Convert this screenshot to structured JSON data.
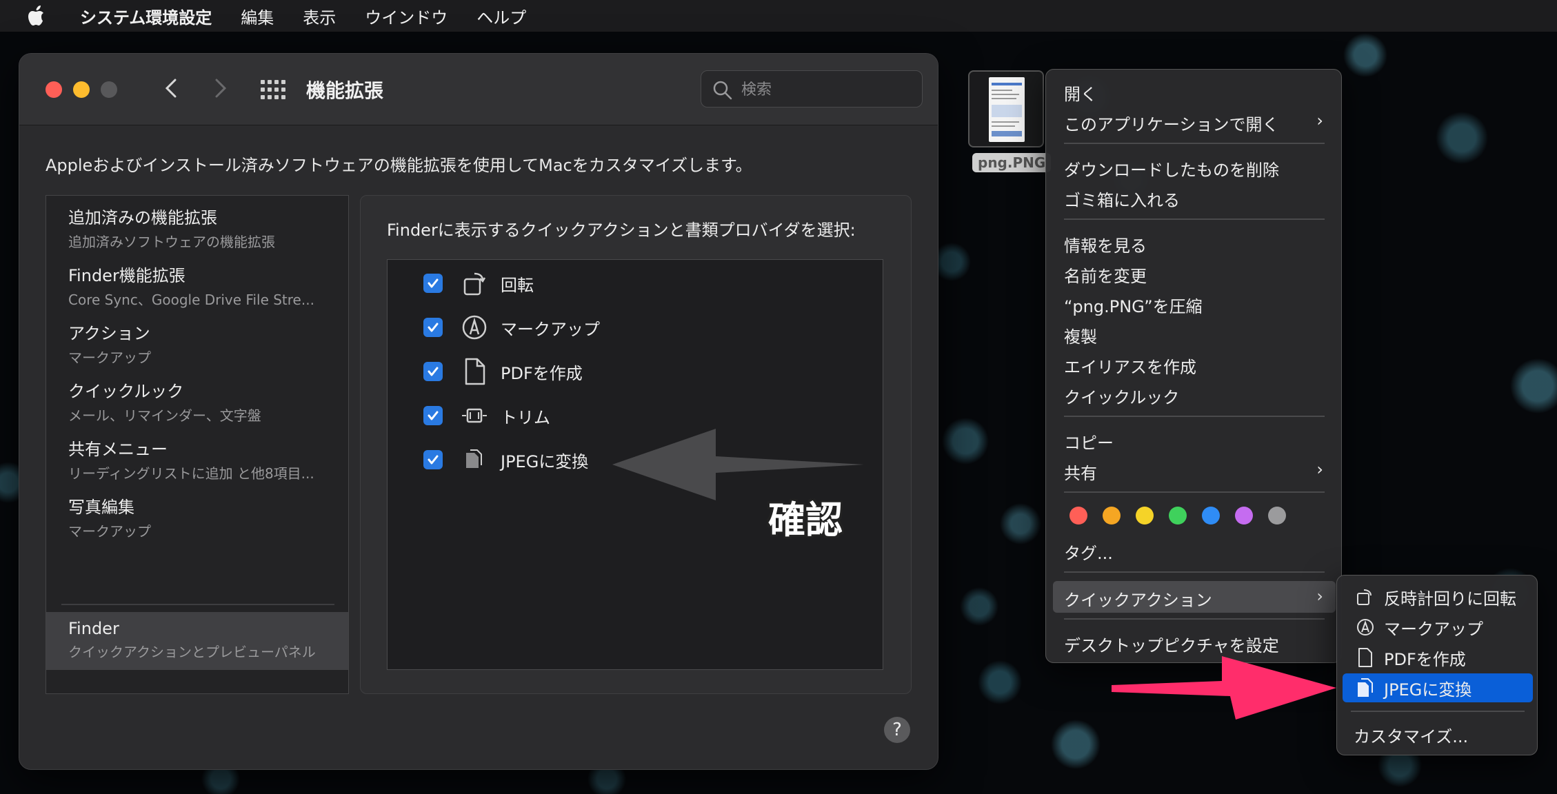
{
  "menubar": {
    "app_name": "システム環境設定",
    "items": [
      "編集",
      "表示",
      "ウインドウ",
      "ヘルプ"
    ]
  },
  "window": {
    "title": "機能拡張",
    "search_placeholder": "検索",
    "description": "Appleおよびインストール済みソフトウェアの機能拡張を使用してMacをカスタマイズします。",
    "sidebar": [
      {
        "title": "追加済みの機能拡張",
        "subtitle": "追加済みソフトウェアの機能拡張"
      },
      {
        "title": "Finder機能拡張",
        "subtitle": "Core Sync、Google Drive File Stre..."
      },
      {
        "title": "アクション",
        "subtitle": "マークアップ"
      },
      {
        "title": "クイックルック",
        "subtitle": "メール、リマインダー、文字盤"
      },
      {
        "title": "共有メニュー",
        "subtitle": "リーディングリストに追加 と他8項目..."
      },
      {
        "title": "写真編集",
        "subtitle": "マークアップ"
      },
      {
        "title": "Finder",
        "subtitle": "クイックアクションとプレビューパネル",
        "selected": true
      }
    ],
    "panel_heading": "Finderに表示するクイックアクションと書類プロバイダを選択:",
    "actions": [
      {
        "label": "回転",
        "checked": true,
        "icon": "rotate-icon"
      },
      {
        "label": "マークアップ",
        "checked": true,
        "icon": "markup-icon"
      },
      {
        "label": "PDFを作成",
        "checked": true,
        "icon": "document-icon"
      },
      {
        "label": "トリム",
        "checked": true,
        "icon": "trim-icon"
      },
      {
        "label": "JPEGに変換",
        "checked": true,
        "icon": "convert-icon"
      }
    ],
    "annotation": "確認",
    "help": "?"
  },
  "desktop_file": {
    "name": "png.PNG"
  },
  "context_menu": {
    "items": {
      "open": "開く",
      "open_with": "このアプリケーションで開く",
      "delete_download": "ダウンロードしたものを削除",
      "trash": "ゴミ箱に入れる",
      "info": "情報を見る",
      "rename": "名前を変更",
      "compress": "“png.PNG”を圧縮",
      "duplicate": "複製",
      "alias": "エイリアスを作成",
      "quicklook": "クイックルック",
      "copy": "コピー",
      "share": "共有",
      "tags": "タグ...",
      "quick_actions": "クイックアクション",
      "set_desktop": "デスクトップピクチャを設定"
    },
    "tag_colors": [
      "#ff5f57",
      "#f5a623",
      "#f5d328",
      "#3fd15c",
      "#2f8cf5",
      "#c56cf0",
      "#9b9b9d"
    ]
  },
  "submenu": {
    "items": [
      "反時計回りに回転",
      "マークアップ",
      "PDFを作成",
      "JPEGに変換"
    ],
    "customize": "カスタマイズ...",
    "selected": "JPEGに変換"
  }
}
